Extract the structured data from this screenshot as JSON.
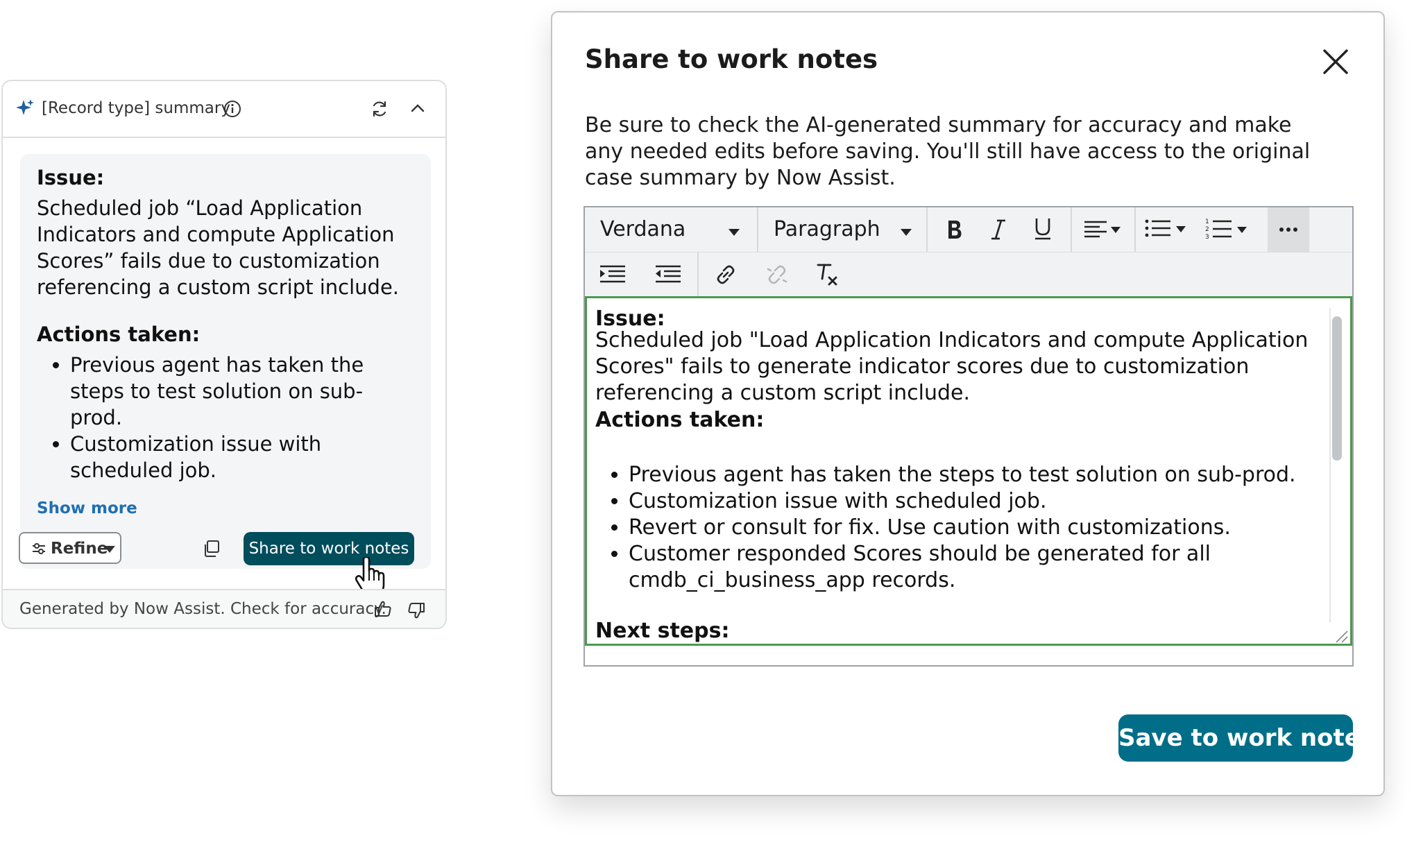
{
  "card": {
    "title": "[Record type] summary",
    "issue_label": "Issue:",
    "issue_text": "Scheduled job “Load Application Indicators and compute Application Scores” fails due to customization referencing a custom script include.",
    "actions_label": "Actions taken:",
    "actions": [
      "Previous agent has taken the steps to test solution on sub-prod.",
      "Customization issue with scheduled job."
    ],
    "show_more": "Show more",
    "refine_label": "Refine",
    "share_label": "Share to work notes",
    "footer_text": "Generated by Now Assist. Check for accuracy.",
    "icons": [
      "sparkle-icon",
      "info-icon",
      "refresh-icon",
      "chevron-up-icon",
      "sliders-icon",
      "caret-down-icon",
      "copy-icon",
      "hand-cursor-icon",
      "thumbs-up-icon",
      "thumbs-down-icon"
    ]
  },
  "modal": {
    "title": "Share to work notes",
    "description": "Be sure to check the AI-generated summary for accuracy and make any needed edits before saving. You'll still have access to the original case summary by Now Assist.",
    "toolbar": {
      "font": "Verdana",
      "block": "Paragraph",
      "icons": [
        "bold-icon",
        "italic-icon",
        "underline-icon",
        "align-left-icon",
        "bullet-list-icon",
        "numbered-list-icon",
        "more-icon",
        "indent-icon",
        "outdent-icon",
        "link-icon",
        "unlink-icon",
        "clear-format-icon"
      ]
    },
    "content": {
      "issue_label": "Issue:",
      "issue_text": "Scheduled job \"Load Application Indicators and compute Application Scores\" fails to generate indicator scores due to customization referencing a custom script include.",
      "actions_label": "Actions taken:",
      "actions": [
        "Previous agent has taken the steps to test solution on sub-prod.",
        "Customization issue with scheduled job.",
        "Revert or consult for fix. Use caution with customizations.",
        "Customer responded Scores should be generated for all cmdb_ci_business_app records."
      ],
      "next_label": "Next steps:"
    },
    "save_label": "Save to work notes"
  },
  "colors": {
    "share_button": "#004d5c",
    "save_button": "#006e88",
    "link": "#1f6fb2",
    "editor_focus": "#4a9a4d"
  }
}
